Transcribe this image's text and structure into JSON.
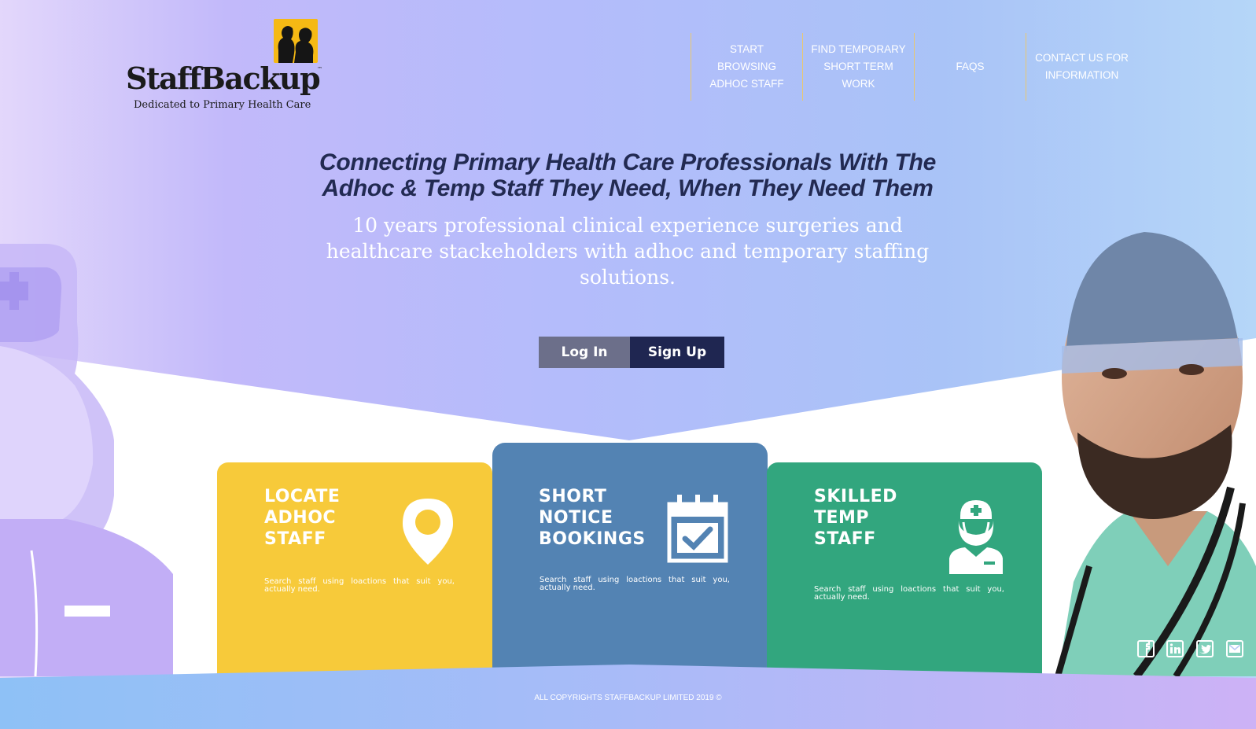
{
  "brand": {
    "name": "StaffBackup",
    "tm": "™",
    "tagline": "Dedicated to Primary Health Care"
  },
  "nav": {
    "items": [
      {
        "label": "START BROWSING ADHOC STAFF"
      },
      {
        "label": "FIND TEMPORARY SHORT TERM WORK"
      },
      {
        "label": "FAQS"
      },
      {
        "label": "CONTACT US FOR INFORMATION"
      }
    ]
  },
  "hero": {
    "title": "Connecting Primary Health Care Professionals With The Adhoc & Temp Staff They Need, When They Need Them",
    "subtitle": "10 years professional clinical experience surgeries and healthcare stackeholders with adhoc and temporary staffing solutions.",
    "login_label": "Log In",
    "signup_label": "Sign Up"
  },
  "cards": [
    {
      "title_line1": "LOCATE",
      "title_line2": "ADHOC",
      "title_line3": "STAFF",
      "text": "Search staff using loactions that suit you, actually need.",
      "icon": "location-pin-icon",
      "color": "#f7ca3a"
    },
    {
      "title_line1": "SHORT",
      "title_line2": "NOTICE",
      "title_line3": "BOOKINGS",
      "text": "Search staff using loactions that suit you, actually need.",
      "icon": "calendar-check-icon",
      "color": "#5383b3"
    },
    {
      "title_line1": "SKILLED",
      "title_line2": "TEMP",
      "title_line3": "STAFF",
      "text": "Search staff using loactions that suit you, actually need.",
      "icon": "nurse-icon",
      "color": "#32a67e"
    }
  ],
  "footer": {
    "copyright": "ALL COPYRIGHTS STAFFBACKUP LIMITED 2019 ©"
  },
  "social": [
    "facebook-icon",
    "linkedin-icon",
    "twitter-icon",
    "email-icon"
  ],
  "colors": {
    "heading": "#222a52",
    "signup": "#1f2651",
    "login": "#6c6f8a",
    "logo_accent": "#f5b914"
  }
}
